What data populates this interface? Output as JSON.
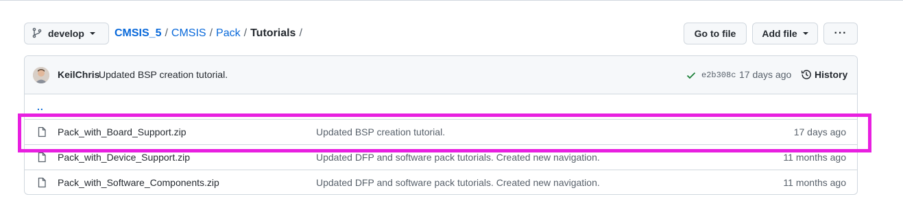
{
  "toolbar": {
    "branch_icon": "git-branch-icon",
    "branch_label": "develop",
    "go_to_file_label": "Go to file",
    "add_file_label": "Add file",
    "more_label": "···"
  },
  "breadcrumb": {
    "root": "CMSIS_5",
    "items": [
      "CMSIS",
      "Pack"
    ],
    "current": "Tutorials",
    "separator": "/"
  },
  "commit": {
    "avatar_icon": "user-avatar",
    "author": "KeilChris",
    "message": "Updated BSP creation tutorial.",
    "status_icon": "check-icon",
    "status_color": "#1a7f37",
    "sha": "e2b308c",
    "time": "17 days ago",
    "history_icon": "history-icon",
    "history_label": "History"
  },
  "parent_dir": "..",
  "files": [
    {
      "icon": "file-icon",
      "name": "Pack_with_Board_Support.zip",
      "message": "Updated BSP creation tutorial.",
      "age": "17 days ago"
    },
    {
      "icon": "file-icon",
      "name": "Pack_with_Device_Support.zip",
      "message": "Updated DFP and software pack tutorials. Created new navigation.",
      "age": "11 months ago"
    },
    {
      "icon": "file-icon",
      "name": "Pack_with_Software_Components.zip",
      "message": "Updated DFP and software pack tutorials. Created new navigation.",
      "age": "11 months ago"
    }
  ],
  "highlight_color": "#e81fe0",
  "link_color": "#0969da"
}
